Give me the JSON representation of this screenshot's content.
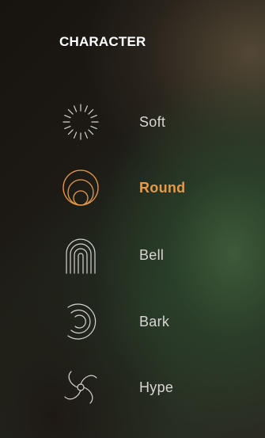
{
  "section": {
    "title": "CHARACTER"
  },
  "colors": {
    "accent": "#e79a4a",
    "text": "#d8d6d2",
    "icon_stroke": "#d7d5d1"
  },
  "options": [
    {
      "label": "Soft",
      "icon": "sunburst-icon",
      "selected": false
    },
    {
      "label": "Round",
      "icon": "nested-circles-icon",
      "selected": true
    },
    {
      "label": "Bell",
      "icon": "arches-icon",
      "selected": false
    },
    {
      "label": "Bark",
      "icon": "spiral-arcs-icon",
      "selected": false
    },
    {
      "label": "Hype",
      "icon": "swirl-icon",
      "selected": false
    }
  ]
}
